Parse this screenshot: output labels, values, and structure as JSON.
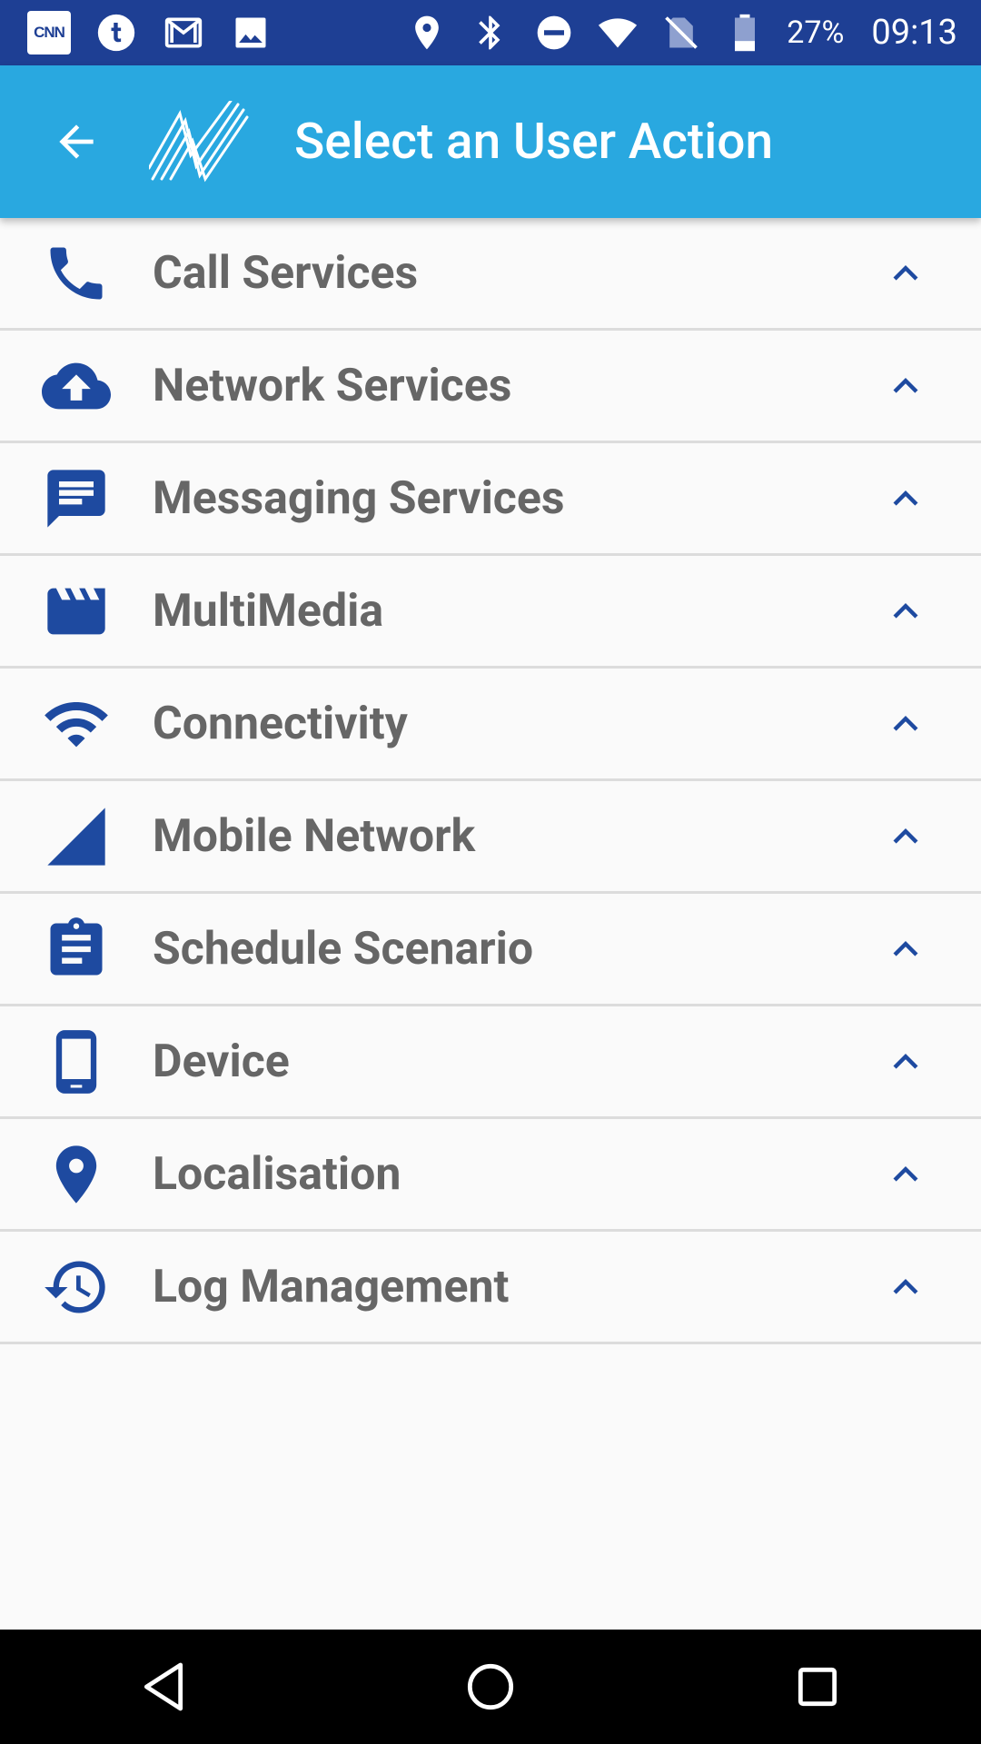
{
  "status_bar": {
    "left_icons": [
      "cnn-icon",
      "tumblr-icon",
      "gmail-icon",
      "image-icon"
    ],
    "cnn_text": "CNN",
    "right_icons": [
      "location-icon",
      "bluetooth-icon",
      "do-not-disturb-icon",
      "wifi-icon",
      "no-sim-icon",
      "battery-icon"
    ],
    "battery_percent": "27%",
    "time": "09:13"
  },
  "app_bar": {
    "title": "Select an User Action",
    "colors": {
      "app_bar": "#29a8e0",
      "status_bar": "#1e3f94",
      "icon_accent": "#1e4aa0"
    }
  },
  "menu": {
    "items": [
      {
        "label": "Call Services",
        "icon": "phone-icon"
      },
      {
        "label": "Network Services",
        "icon": "cloud-upload-icon"
      },
      {
        "label": "Messaging Services",
        "icon": "message-icon"
      },
      {
        "label": "MultiMedia",
        "icon": "movie-icon"
      },
      {
        "label": "Connectivity",
        "icon": "wifi-icon"
      },
      {
        "label": "Mobile Network",
        "icon": "signal-icon"
      },
      {
        "label": "Schedule Scenario",
        "icon": "clipboard-icon"
      },
      {
        "label": "Device",
        "icon": "smartphone-icon"
      },
      {
        "label": "Localisation",
        "icon": "location-pin-icon"
      },
      {
        "label": "Log Management",
        "icon": "history-icon"
      }
    ]
  },
  "nav_bar": {
    "buttons": [
      "back-triangle-icon",
      "home-circle-icon",
      "recents-square-icon"
    ]
  }
}
